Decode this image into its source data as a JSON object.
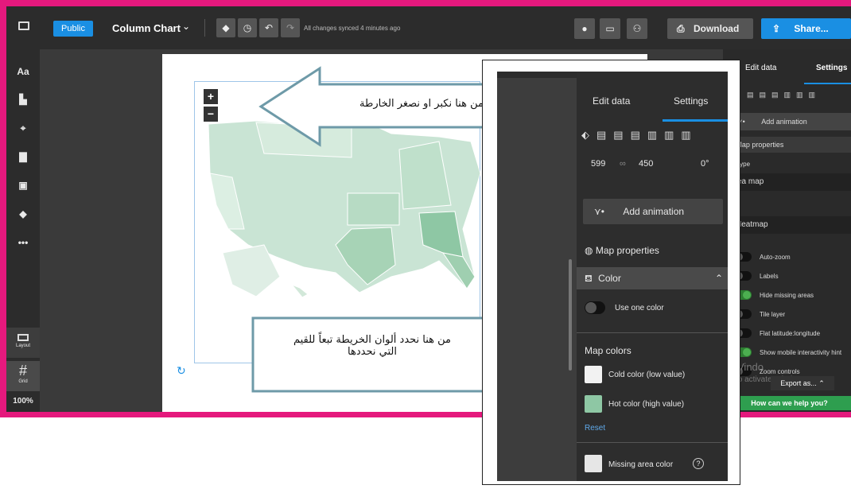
{
  "topbar": {
    "badge": "Public",
    "chart_type": "Column Chart",
    "sync_status": "All changes synced 4 minutes ago",
    "download_label": "Download",
    "share_label": "Share..."
  },
  "sidebar": {
    "items": [
      {
        "icon": "monitor-icon"
      },
      {
        "label": "Aa",
        "icon": "text-icon"
      },
      {
        "icon": "bar-chart-icon"
      },
      {
        "icon": "map-icon"
      },
      {
        "icon": "layout-icon"
      },
      {
        "icon": "image-icon"
      },
      {
        "icon": "shapes-icon"
      },
      {
        "label": "•••",
        "icon": "more-icon"
      }
    ],
    "layout_label": "Layout",
    "grid_label": "Grid",
    "zoom": "100%"
  },
  "map_controls": {
    "zoom_in": "+",
    "zoom_out": "−"
  },
  "right_panel": {
    "tab_edit": "Edit data",
    "tab_settings": "Settings",
    "add_animation": "Add animation",
    "map_properties": "Map properties",
    "map_type_label": "lap type",
    "map_type_value": "Area map",
    "style_label": "tyle",
    "style_value": "Heatmap",
    "toggles": [
      {
        "label": "Auto-zoom",
        "on": false
      },
      {
        "label": "Labels",
        "on": false
      },
      {
        "label": "Hide missing areas",
        "on": true
      },
      {
        "label": "Tile layer",
        "on": false
      },
      {
        "label": "Flat latitude:longitude",
        "on": false
      },
      {
        "label": "Show mobile interactivity hint",
        "on": true
      },
      {
        "label": "Zoom controls",
        "on": false
      }
    ],
    "watermark_1": "Vindo",
    "watermark_2": "is to activate Windows.",
    "export_label": "Export as...",
    "help_label": "How can we help you?"
  },
  "overlay": {
    "tab_edit": "Edit data",
    "tab_settings": "Settings",
    "width": "599",
    "height": "450",
    "rotation": "0°",
    "add_animation": "Add animation",
    "map_properties": "Map properties",
    "color_section": "Color",
    "use_one_color": "Use one color",
    "map_colors": "Map colors",
    "cold_color_label": "Cold color (low value)",
    "hot_color_label": "Hot color (high value)",
    "reset": "Reset",
    "missing_color_label": "Missing area color",
    "cold_color": "#f2f2f2",
    "hot_color": "#8ec7a4",
    "missing_color": "#e6e6e6"
  },
  "callouts": {
    "zoom_text": "من هنا نكبر او نصغر الخارطة",
    "color_text_line1": "من هنا نحدد ألوان الخريطة  تبعاً للقيم",
    "color_text_line2": "التي نحددها"
  },
  "colors": {
    "accent_blue": "#1a8fe3",
    "frame_pink": "#e5197d",
    "help_green": "#2e9e4f"
  }
}
